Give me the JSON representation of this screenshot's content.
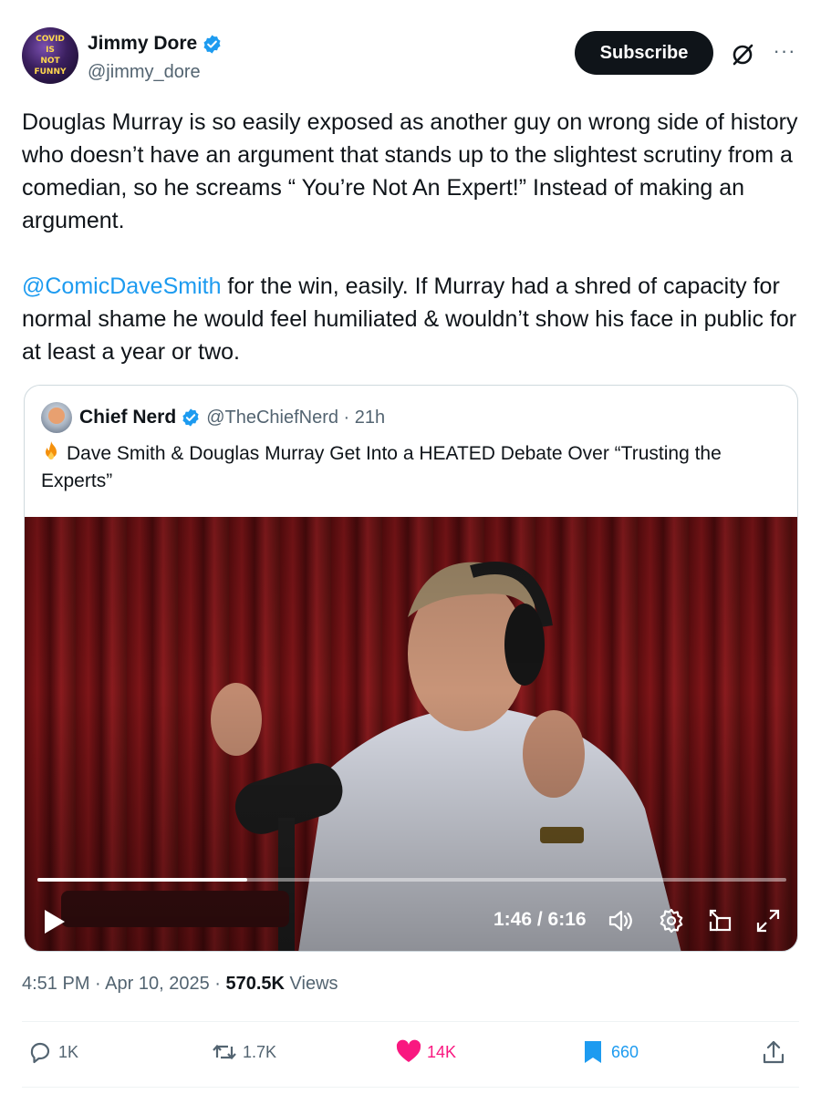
{
  "author": {
    "name": "Jimmy Dore",
    "handle": "@jimmy_dore",
    "avatar_text": [
      "COVID",
      "IS",
      "NOT",
      "FUNNY"
    ]
  },
  "header": {
    "subscribe_label": "Subscribe",
    "grok_icon": "slash-circle-icon",
    "more_icon": "more-icon"
  },
  "tweet": {
    "paragraph1": "Douglas Murray is so easily exposed as another guy on wrong side of history who doesn’t have an argument that stands up to the slightest scrutiny from a comedian, so he screams “ You’re Not An Expert!” Instead of making an argument.",
    "mention": "@ComicDaveSmith",
    "paragraph2_rest": " for the win, easily. If Murray had a shred of capacity for normal shame he would feel humiliated & wouldn’t show his face in public for at least a year or two."
  },
  "quote": {
    "name": "Chief Nerd",
    "handle_time": "@TheChiefNerd · 21h",
    "text": "Dave Smith & Douglas Murray Get Into a HEATED Debate Over “Trusting the Experts”",
    "emoji_icon": "fire-icon"
  },
  "video": {
    "time": "1:46 / 6:16",
    "progress": 0.28,
    "controls": [
      "play-icon",
      "volume-icon",
      "settings-icon",
      "picture-in-picture-icon",
      "fullscreen-icon"
    ]
  },
  "meta": {
    "time": "4:51 PM",
    "date": "Apr 10, 2025",
    "views_count": "570.5K",
    "views_label": "Views"
  },
  "actions": {
    "replies": "1K",
    "reposts": "1.7K",
    "likes": "14K",
    "bookmarks": "660"
  },
  "colors": {
    "accent": "#1d9bf0",
    "like": "#f91880",
    "text": "#0f1419",
    "muted": "#536471"
  }
}
